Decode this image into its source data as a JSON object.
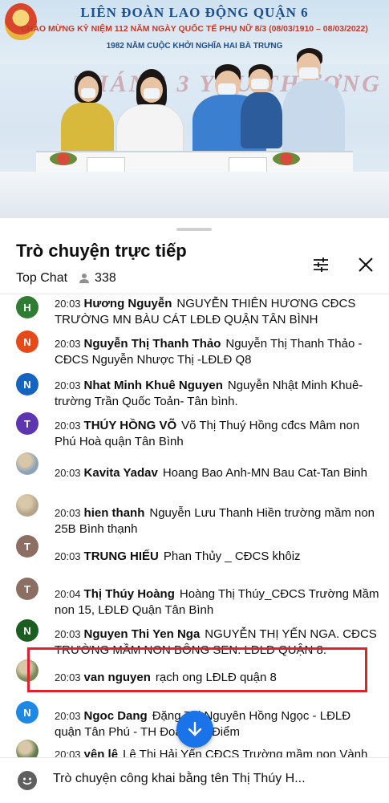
{
  "video": {
    "banner_title": "LIÊN ĐOÀN LAO ĐỘNG QUẬN 6",
    "banner_subtitle": "CHÀO MỪNG KỶ NIỆM 112 NĂM NGÀY QUỐC TẾ PHỤ NỮ 8/3 (08/03/1910 – 08/03/2022)",
    "banner_subtitle2": "1982 NĂM CUỘC KHỞI NGHĨA HAI BÀ TRƯNG",
    "backdrop_text": "THÁNG 3 YÊU THƯƠNG"
  },
  "chat": {
    "title": "Trò chuyện trực tiếp",
    "mode": "Top Chat",
    "viewer_count": "338",
    "messages": [
      {
        "time": "20:03",
        "author": "Hương Nguyễn",
        "text": "NGUYỄN THIÊN HƯƠNG CĐCS TRƯỜNG MN BÀU CÁT LĐLĐ QUẬN TÂN BÌNH",
        "initial": "H",
        "color": "#2e7d32"
      },
      {
        "time": "20:03",
        "author": "Nguyễn Thị Thanh Thảo",
        "text": "Nguyễn Thị Thanh Thảo -CĐCS Nguyễn Nhược Thị -LĐLĐ Q8",
        "initial": "N",
        "color": "#e64a19"
      },
      {
        "time": "20:03",
        "author": "Nhat Minh Khuê Nguyen",
        "text": "Nguyễn Nhật Minh Khuê-trường Trần Quốc Toản- Tân bình.",
        "initial": "N",
        "color": "#1565c0"
      },
      {
        "time": "20:03",
        "author": "THÚY HỒNG VÕ",
        "text": "Võ Thị Thuý Hồng cđcs Mâm non Phú Hoà quận Tân Bình",
        "initial": "T",
        "color": "#5e35b1"
      },
      {
        "time": "20:03",
        "author": "Kavita Yadav",
        "text": "Hoang Bao Anh-MN Bau Cat-Tan Binh",
        "initial": "",
        "color": "#8aa3b8"
      },
      {
        "time": "20:03",
        "author": "hien thanh",
        "text": "Nguyễn Lưu Thanh Hiền trường mầm non 25B Bình thạnh",
        "initial": "",
        "color": "#b6a48a"
      },
      {
        "time": "20:03",
        "author": "TRUNG HIẾU",
        "text": "Phan Thủy _ CĐCS khôiz",
        "initial": "T",
        "color": "#8d6e63"
      },
      {
        "time": "20:04",
        "author": "Thị Thúy Hoàng",
        "text": "Hoàng Thị Thúy_CĐCS Trường Mầm non 15, LĐLĐ Quận Tân Bình",
        "initial": "T",
        "color": "#8d6e63"
      },
      {
        "time": "20:03",
        "author": "Nguyen Thi Yen Nga",
        "text": "NGUYỄN THỊ YẾN NGA. CĐCS TRƯỜNG MẦM NON BÔNG SEN. LĐLĐ QUẬN 8.",
        "initial": "N",
        "color": "#1b5e20"
      },
      {
        "time": "20:03",
        "author": "van nguyen",
        "text": "rạch ong LĐLĐ quận 8",
        "initial": "",
        "color": "#7a8a5a"
      },
      {
        "time": "20:03",
        "author": "Ngoc Dang",
        "text": "Đặng Thị Nguyên Hồng Ngọc - LĐLĐ quận Tân Phú - TH Đoàn Thị Điểm",
        "initial": "N",
        "color": "#1e88e5"
      },
      {
        "time": "20:03",
        "author": "yên lê",
        "text": "Lê Thị Hải Yến CĐCS Trường mầm non Vành",
        "initial": "",
        "color": "#5d7a4a"
      }
    ],
    "composer_placeholder": "Trò chuyện công khai bằng tên Thị Thúy H..."
  }
}
